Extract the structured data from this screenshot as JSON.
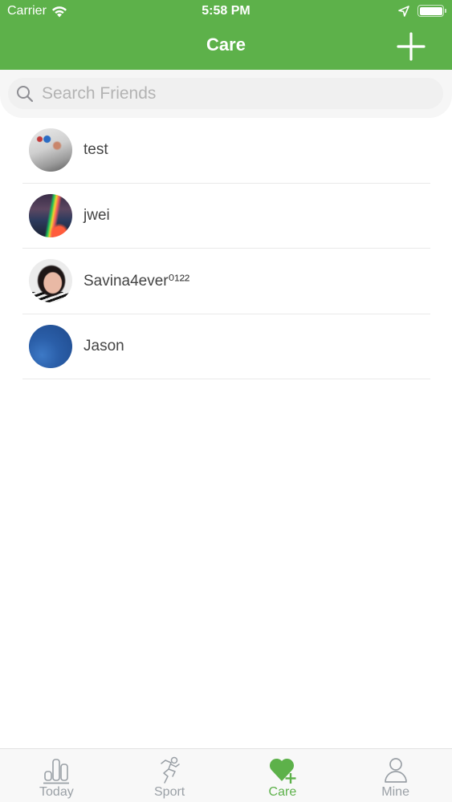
{
  "status_bar": {
    "carrier": "Carrier",
    "time": "5:58 PM",
    "battery_level": 1.0
  },
  "nav": {
    "title": "Care",
    "add_icon": "plus-icon"
  },
  "search": {
    "placeholder": "Search Friends",
    "value": "",
    "icon": "search-icon"
  },
  "friends": [
    {
      "name": "test",
      "avatar": "photo"
    },
    {
      "name": "jwei",
      "avatar": "photo"
    },
    {
      "name": "Savina4ever⁰¹²²",
      "avatar": "photo"
    },
    {
      "name": "Jason",
      "avatar": "photo"
    }
  ],
  "tabs": [
    {
      "label": "Today",
      "icon": "bar-chart-icon",
      "active": false
    },
    {
      "label": "Sport",
      "icon": "running-person-icon",
      "active": false
    },
    {
      "label": "Care",
      "icon": "heart-plus-icon",
      "active": true
    },
    {
      "label": "Mine",
      "icon": "person-icon",
      "active": false
    }
  ],
  "colors": {
    "brand_green": "#5db14a",
    "tab_inactive": "#9aa0a6",
    "text_primary": "#444444",
    "placeholder": "#b3b3b3"
  }
}
